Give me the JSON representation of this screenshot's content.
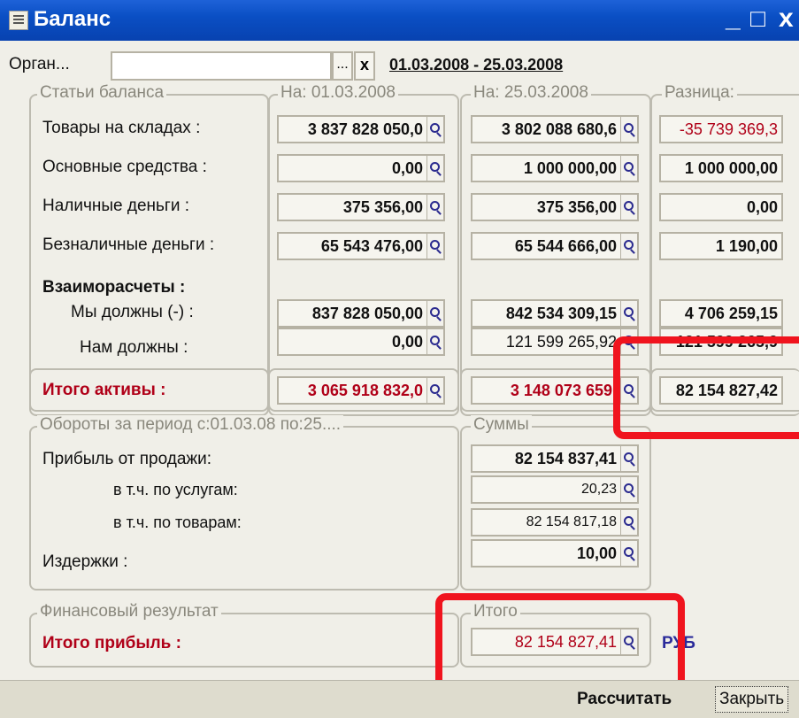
{
  "window": {
    "title": "Баланс",
    "minimize": "_",
    "maximize": "□",
    "close": "x"
  },
  "org": {
    "label": "Орган...",
    "value": "",
    "dots": "...",
    "clear": "x",
    "period": "01.03.2008 - 25.03.2008"
  },
  "balance": {
    "group_label": "Статьи баланса",
    "col1_label": "На: 01.03.2008",
    "col2_label": "На: 25.03.2008",
    "col3_label": "Разница:",
    "rows": [
      {
        "label": "Товары на складах :",
        "v1": "3 837 828 050,0",
        "v2": "3 802 088 680,6",
        "v3": "-35 739 369,3"
      },
      {
        "label": "Основные средства :",
        "v1": "0,00",
        "v2": "1 000 000,00",
        "v3": "1 000 000,00"
      },
      {
        "label": "Наличные деньги :",
        "v1": "375 356,00",
        "v2": "375 356,00",
        "v3": "0,00"
      },
      {
        "label": "Безналичные деньги :",
        "v1": "65 543 476,00",
        "v2": "65 544 666,00",
        "v3": "1 190,00"
      }
    ],
    "settlements_label": "Взаиморасчеты :",
    "we_owe": {
      "label": "Мы должны (-) :",
      "v1": "837 828 050,00",
      "v2": "842 534 309,15",
      "v3": "4 706 259,15"
    },
    "owed_to_us": {
      "label": "Нам должны :",
      "v1": "0,00",
      "v2": "121 599 265,92",
      "v3": "121 599 265,9"
    }
  },
  "assets_total": {
    "label": "Итого активы :",
    "v1": "3 065 918 832,0",
    "v2": "3 148 073 659,",
    "v3": "82 154 827,42"
  },
  "turnover": {
    "group_label": "Обороты за период с:01.03.08 по:25....",
    "sums_label": "Суммы",
    "rows": [
      {
        "label": "Прибыль от продажи:",
        "value": "82 154 837,41"
      },
      {
        "label": "в т.ч. по услугам:",
        "value": "20,23"
      },
      {
        "label": "в т.ч. по товарам:",
        "value": "82 154 817,18"
      },
      {
        "label": "Издержки :",
        "value": "10,00"
      }
    ]
  },
  "result": {
    "group_label": "Финансовый результат",
    "total_group_label": "Итого",
    "profit_label": "Итого прибыль :",
    "profit_value": "82 154 827,41",
    "currency": "РУБ"
  },
  "buttons": {
    "calculate": "Рассчитать",
    "close": "Закрыть"
  },
  "colors": {
    "highlight_box": "#f0141e",
    "total_red": "#b00018",
    "titlebar": "#0a4fc4"
  }
}
